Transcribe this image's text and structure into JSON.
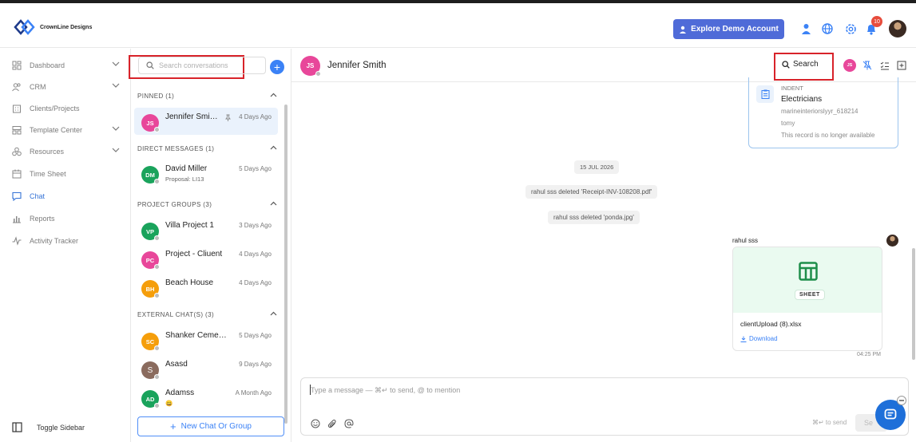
{
  "brand": {
    "name": "CrownLine Designs"
  },
  "topbar": {
    "demo_label": "Explore Demo Account",
    "notif_count": "10"
  },
  "sidebar": {
    "items": [
      {
        "label": "Dashboard"
      },
      {
        "label": "CRM"
      },
      {
        "label": "Clients/Projects"
      },
      {
        "label": "Template Center"
      },
      {
        "label": "Resources"
      },
      {
        "label": "Time Sheet"
      },
      {
        "label": "Chat"
      },
      {
        "label": "Reports"
      },
      {
        "label": "Activity Tracker"
      }
    ],
    "active": "Chat",
    "toggle_label": "Toggle Sidebar"
  },
  "conversations": {
    "search_placeholder": "Search conversations",
    "sections": [
      {
        "title": "PINNED (1)"
      },
      {
        "title": "DIRECT MESSAGES (1)"
      },
      {
        "title": "PROJECT GROUPS (3)"
      },
      {
        "title": "EXTERNAL CHAT(S) (3)"
      }
    ],
    "items": [
      {
        "initials": "JS",
        "name": "Jennifer Smi…",
        "time": "4 Days Ago",
        "color": "#e8479a"
      },
      {
        "initials": "DM",
        "name": "David Miller",
        "time": "5 Days Ago",
        "sub": "Proposal: LI13",
        "color": "#1aa35c"
      },
      {
        "initials": "VP",
        "name": "Villa Project 1",
        "time": "3 Days Ago",
        "color": "#1aa35c"
      },
      {
        "initials": "PC",
        "name": "Project - Cliuent",
        "time": "4 Days Ago",
        "color": "#e8479a"
      },
      {
        "initials": "BH",
        "name": "Beach House",
        "time": "4 Days Ago",
        "color": "#f59e0b"
      },
      {
        "initials": "SC",
        "name": "Shanker Ceme…",
        "time": "5 Days Ago",
        "color": "#f59e0b"
      },
      {
        "initials": "S",
        "name": "Asasd",
        "time": "9 Days Ago",
        "color": "#8a6b5e"
      },
      {
        "initials": "AD",
        "name": "Adamss",
        "time": "A Month Ago",
        "sub": "😀",
        "color": "#1aa35c"
      }
    ],
    "new_chat_label": "New Chat Or Group"
  },
  "chat": {
    "header": {
      "initials": "JS",
      "name": "Jennifer Smith",
      "search_label": "Search",
      "mini_initials": "JS"
    },
    "record_card": {
      "tag": "INDENT",
      "title": "Electricians",
      "line1": "marineinteriorslyyr_618214",
      "line2": "tomy",
      "note": "This record is no longer available"
    },
    "date_divider": "15 JUL 2026",
    "system_messages": [
      "rahul sss deleted 'Receipt-INV-108208.pdf'",
      "rahul sss deleted 'ponda.jpg'"
    ],
    "message": {
      "sender": "rahul sss",
      "file_label": "SHEET",
      "file_name": "clientUpload (8).xlsx",
      "download_label": "Download",
      "time": "04:25 PM"
    },
    "composer": {
      "placeholder": "Type a message — ⌘↵ to send, @ to mention",
      "enter_hint": "⌘↵ to send",
      "send_label": "Se"
    }
  },
  "colors": {
    "accent": "#3b82f6",
    "highlight": "#d8232a",
    "demo": "#4f6bd8"
  }
}
